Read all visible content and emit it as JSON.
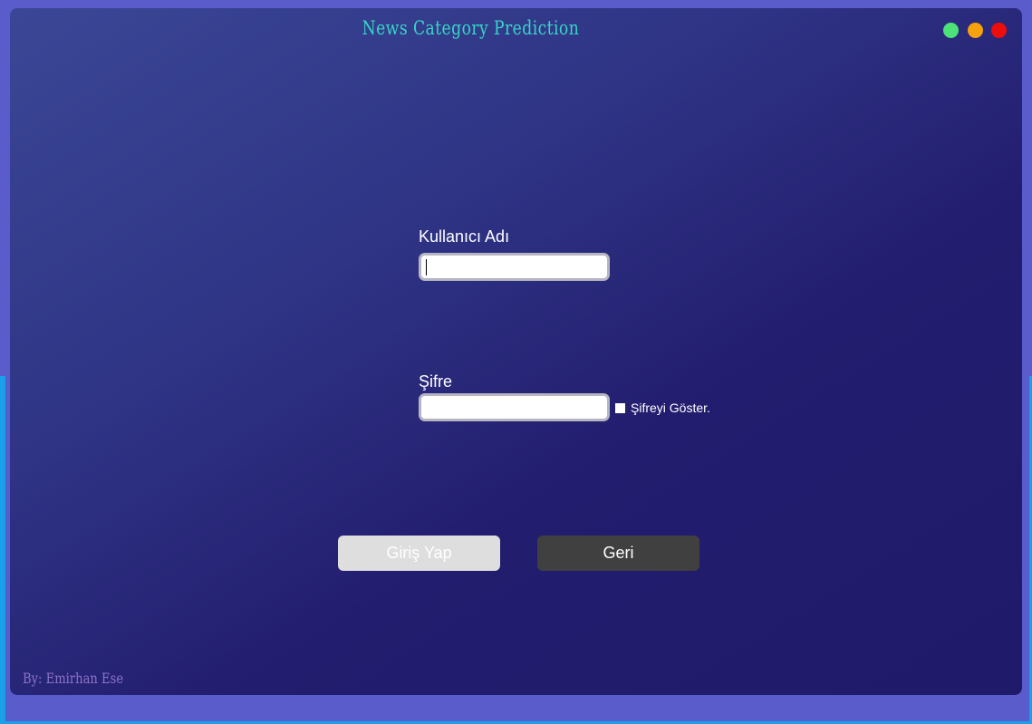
{
  "window": {
    "title": "News Category Prediction",
    "controls": [
      {
        "name": "green",
        "color": "#4be277"
      },
      {
        "name": "orange",
        "color": "#f5a20c"
      },
      {
        "name": "red",
        "color": "#ee0d0d"
      }
    ]
  },
  "form": {
    "username_label": "Kullanıcı Adı",
    "username_value": "",
    "password_label": "Şifre",
    "password_value": "",
    "show_password_label": "Şifreyi Göster.",
    "show_password_checked": false
  },
  "buttons": {
    "login_label": "Giriş Yap",
    "back_label": "Geri"
  },
  "footer": {
    "credit": "By: Emirhan Ese"
  },
  "colors": {
    "title": "#36d6c7",
    "login_button": "#dedede",
    "back_button": "#404040",
    "footer_text": "#8a73c4"
  }
}
